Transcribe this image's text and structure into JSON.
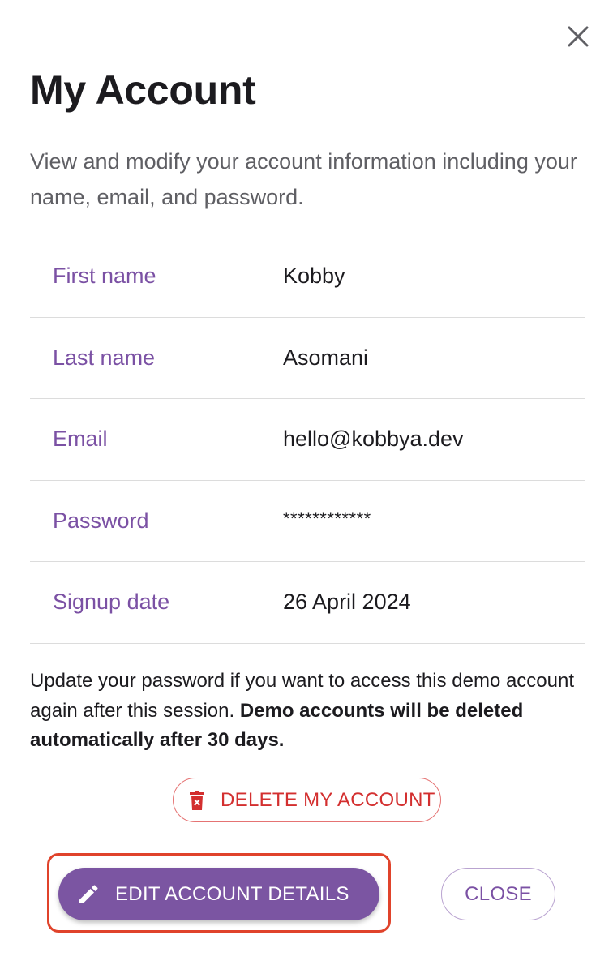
{
  "dialog": {
    "title": "My Account",
    "subtitle": "View and modify your account information including your name, email, and password.",
    "close_icon": "close-icon"
  },
  "fields": [
    {
      "label": "First name",
      "value": "Kobby"
    },
    {
      "label": "Last name",
      "value": "Asomani"
    },
    {
      "label": "Email",
      "value": "hello@kobbya.dev"
    },
    {
      "label": "Password",
      "value": "************"
    },
    {
      "label": "Signup date",
      "value": "26 April 2024"
    }
  ],
  "notice": {
    "text": "Update your password if you want to access this demo account again after this session. ",
    "bold": "Demo accounts will be deleted automatically after 30 days."
  },
  "actions": {
    "delete_label": "DELETE MY ACCOUNT",
    "delete_icon": "trash-icon",
    "edit_label": "EDIT ACCOUNT DETAILS",
    "edit_icon": "pencil-icon",
    "close_label": "CLOSE"
  },
  "colors": {
    "accent": "#7b55a2",
    "label": "#7b51a4",
    "danger": "#d32f2f",
    "highlight": "#e0432b"
  }
}
